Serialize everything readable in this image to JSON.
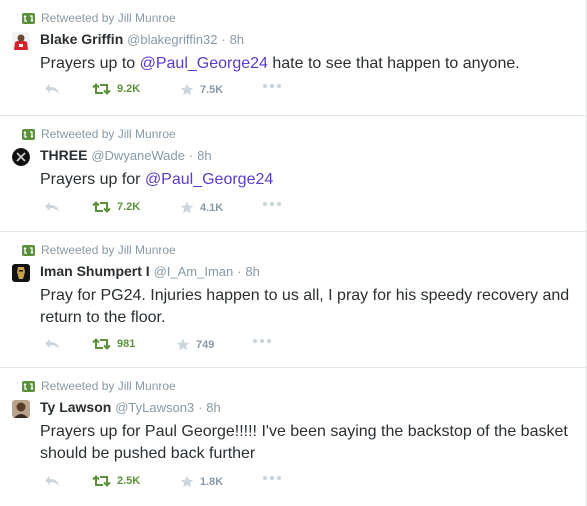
{
  "colors": {
    "retweet_green": "#5c913b",
    "mention": "#5b3bc9",
    "muted": "#8899a6",
    "text": "#292f33",
    "divider": "#e1e8ed"
  },
  "tweets": [
    {
      "context": "Retweeted by Jill Munroe",
      "avatar_icon": "user-avatar-red-jersey",
      "fullname": "Blake Griffin",
      "username": "@blakegriffin32",
      "time": "8h",
      "text_before": "Prayers up to ",
      "mention": "@Paul_George24",
      "text_after": " hate to see that happen to anyone.",
      "retweets": "9.2K",
      "favorites": "7.5K"
    },
    {
      "context": "Retweeted by Jill Munroe",
      "avatar_icon": "user-avatar-x-logo",
      "fullname": "THREE",
      "username": "@DwyaneWade",
      "time": "8h",
      "text_before": "Prayers up for ",
      "mention": "@Paul_George24",
      "text_after": "",
      "retweets": "7.2K",
      "favorites": "4.1K"
    },
    {
      "context": "Retweeted by Jill Munroe",
      "avatar_icon": "user-avatar-black-gold",
      "fullname": "Iman Shumpert I",
      "username": "@I_Am_Iman",
      "time": "8h",
      "text_before": "Pray for PG24. Injuries happen to us all, I pray for his speedy recovery and return to the floor.",
      "mention": "",
      "text_after": "",
      "retweets": "981",
      "favorites": "749"
    },
    {
      "context": "Retweeted by Jill Munroe",
      "avatar_icon": "user-avatar-portrait",
      "fullname": "Ty Lawson",
      "username": "@TyLawson3",
      "time": "8h",
      "text_before": "Prayers up for Paul George!!!!! I've been saying the backstop of the basket should be pushed back further",
      "mention": "",
      "text_after": "",
      "retweets": "2.5K",
      "favorites": "1.8K"
    }
  ]
}
